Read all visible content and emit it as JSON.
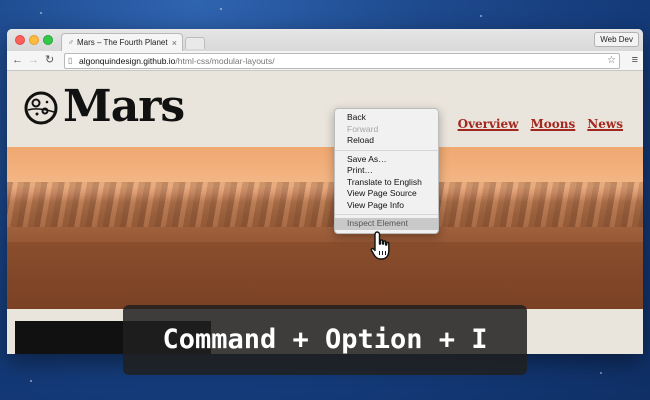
{
  "browser": {
    "tab_title": "Mars – The Fourth Planet",
    "tab_icon": "mars-favicon-icon",
    "extension_button": "Web Dev",
    "url_host": "algonquindesign.github.io",
    "url_path": "/html-css/modular-layouts/"
  },
  "site": {
    "logo_text": "Mars",
    "nav": [
      "Overview",
      "Moons",
      "News"
    ],
    "accent_color": "#a1271f"
  },
  "context_menu": {
    "items": [
      {
        "label": "Back",
        "state": "normal"
      },
      {
        "label": "Forward",
        "state": "disabled"
      },
      {
        "label": "Reload",
        "state": "normal"
      },
      {
        "label": "Save As…",
        "state": "normal"
      },
      {
        "label": "Print…",
        "state": "normal"
      },
      {
        "label": "Translate to English",
        "state": "normal"
      },
      {
        "label": "View Page Source",
        "state": "normal"
      },
      {
        "label": "View Page Info",
        "state": "normal"
      },
      {
        "label": "Inspect Element",
        "state": "highlighted"
      }
    ]
  },
  "shortcut": {
    "text": "Command + Option + I"
  }
}
